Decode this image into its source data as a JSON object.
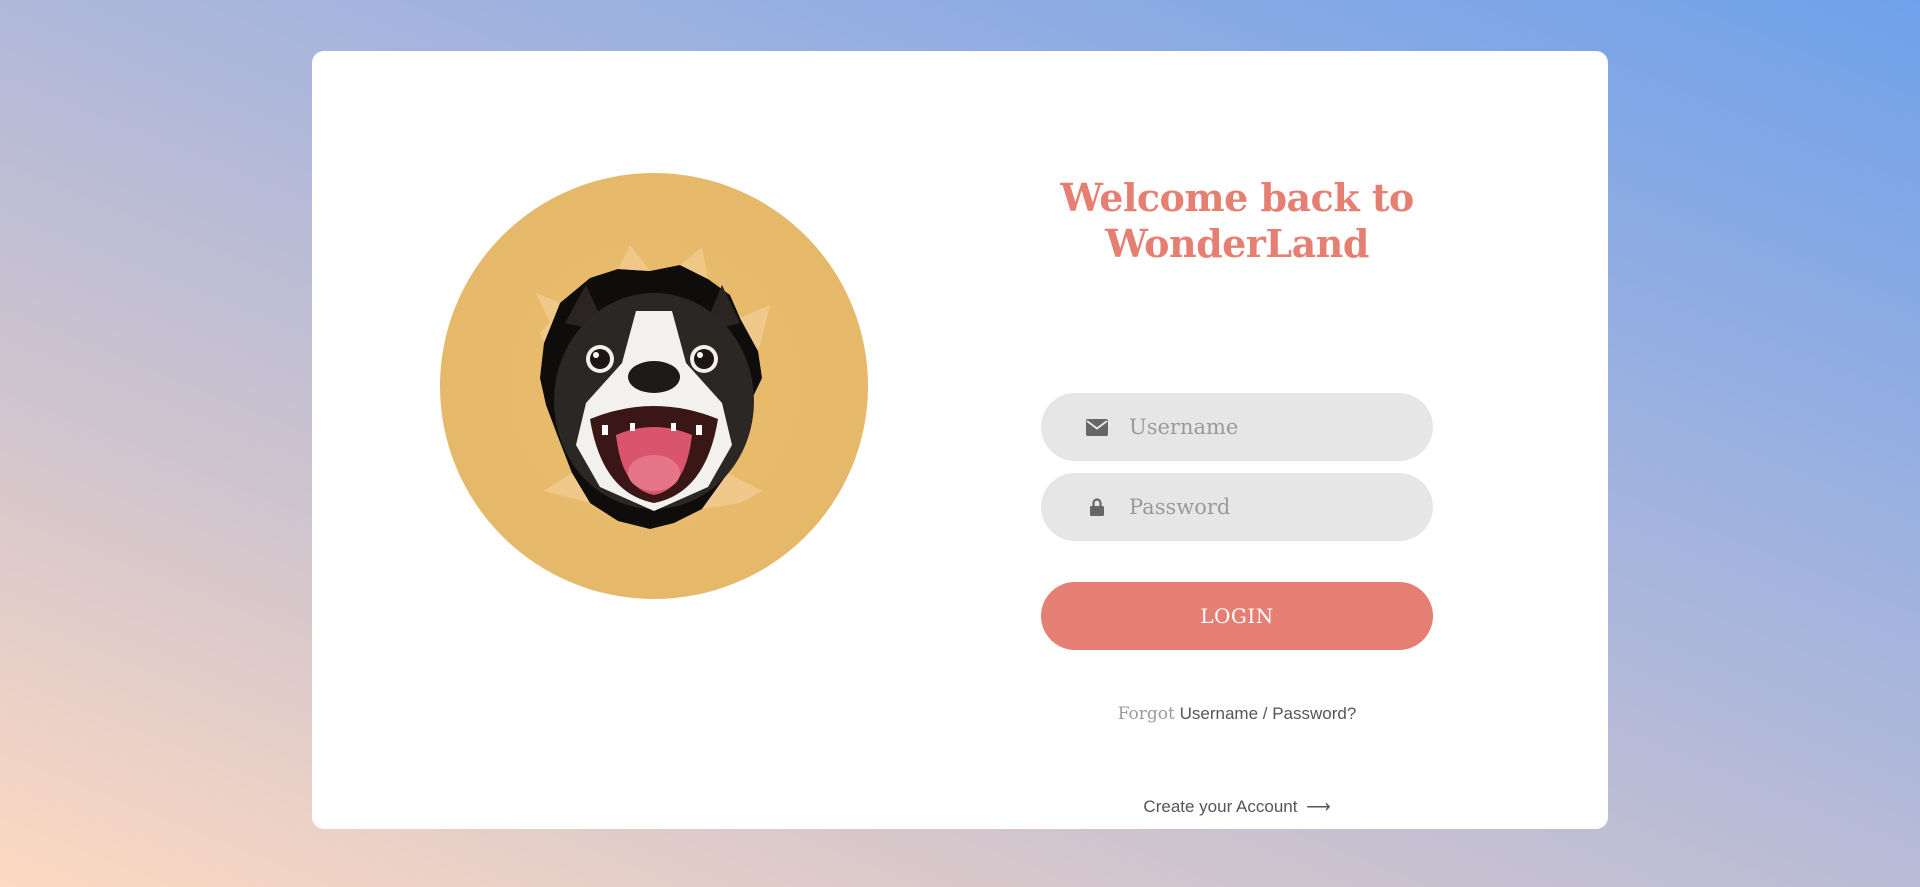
{
  "login": {
    "title_line1": "Welcome back to",
    "title_line2": "WonderLand",
    "username_placeholder": "Username",
    "password_placeholder": "Password",
    "login_label": "LOGIN",
    "forgot_prefix": "Forgot",
    "forgot_link": "Username / Password?",
    "create_account": "Create your Account",
    "icons": {
      "username": "envelope-icon",
      "password": "lock-icon",
      "create": "arrow-right-icon"
    }
  },
  "colors": {
    "accent": "#e67f73",
    "field_bg": "#e6e6e6",
    "hero_bg": "#e7b96b"
  }
}
